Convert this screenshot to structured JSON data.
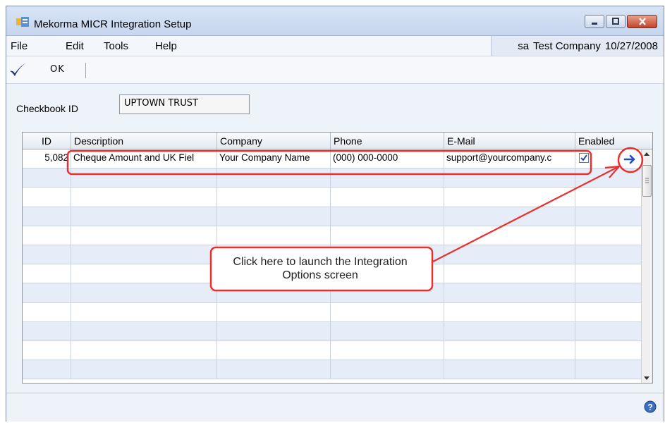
{
  "window": {
    "title": "Mekorma MICR Integration Setup"
  },
  "menu": {
    "file": "File",
    "edit": "Edit",
    "tools": "Tools",
    "help": "Help"
  },
  "user_info": {
    "user": "sa",
    "company": "Test Company",
    "date": "10/27/2008"
  },
  "toolbar": {
    "ok_label": "OK"
  },
  "checkbook": {
    "label": "Checkbook ID",
    "value": "UPTOWN TRUST"
  },
  "grid": {
    "columns": {
      "id": "ID",
      "description": "Description",
      "company": "Company",
      "phone": "Phone",
      "email": "E-Mail",
      "enabled": "Enabled"
    },
    "rows": [
      {
        "id": "5,082",
        "description": "Cheque Amount and UK Fiel",
        "company": "Your Company Name",
        "phone": "(000) 000-0000",
        "email": "support@yourcompany.c",
        "enabled": true
      }
    ]
  },
  "annotation": {
    "callout_line1": "Click here to launch the Integration",
    "callout_line2": "Options screen"
  },
  "colors": {
    "annotation_red": "#e8302c",
    "arrow_blue": "#1f4fc8",
    "title_bar": "#d7e4f5",
    "alt_row": "#e6ecf8"
  }
}
